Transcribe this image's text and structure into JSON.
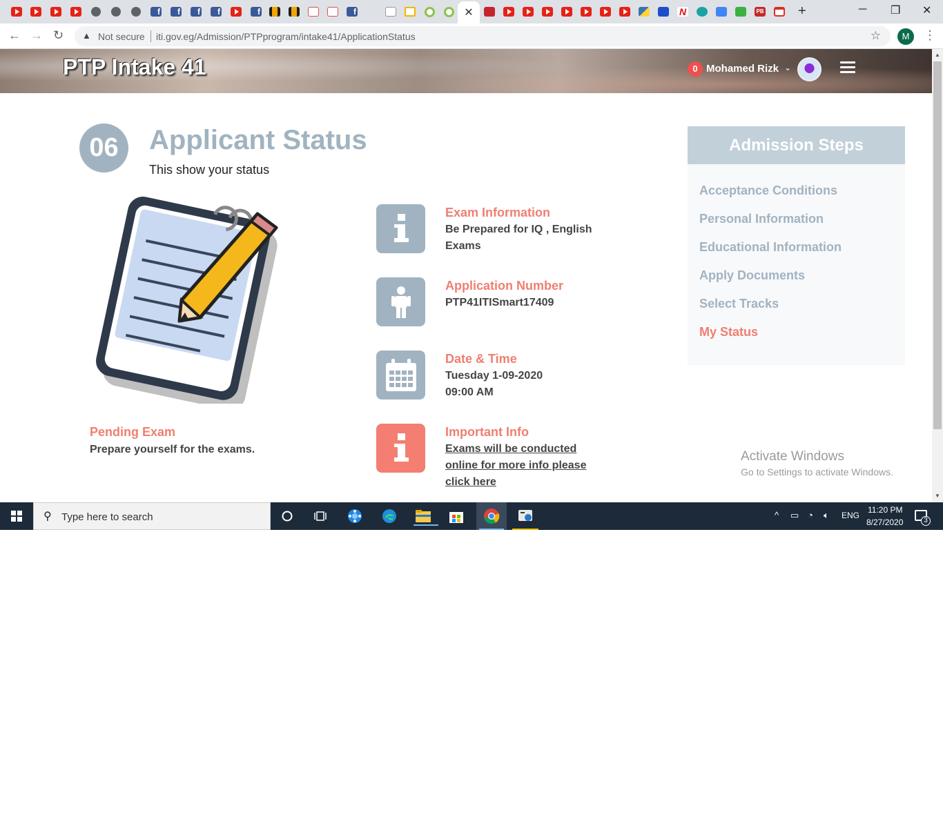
{
  "browser": {
    "tabs": [
      "youtube-tab",
      "youtube-tab",
      "youtube-tab",
      "youtube-tab",
      "globe-tab",
      "globe-tab",
      "globe-tab",
      "facebook-tab",
      "facebook-tab",
      "facebook-tab",
      "facebook-tab",
      "youtube-tab",
      "facebook-tab",
      "bd-tab",
      "bd-tab",
      "calendar-tab",
      "calendar-tab",
      "facebook-tab",
      "a-tab",
      "doc-tab",
      "ring-tab",
      "ring-tab",
      "joomla-tab",
      "active-tab",
      "hi-tab",
      "youtube-tab",
      "youtube-tab",
      "youtube-tab",
      "youtube-tab",
      "youtube-tab",
      "youtube-tab",
      "youtube-tab",
      "python-tab",
      "p-tab",
      "n-tab",
      "eye-tab",
      "translate-tab",
      "green-tab",
      "pb-tab",
      "gmail-tab"
    ],
    "active_tab_close": "✕",
    "new_tab": "+",
    "security_label": "Not secure",
    "url": "iti.gov.eg/Admission/PTPprogram/intake41/ApplicationStatus",
    "profile_initial": "M"
  },
  "header": {
    "brand": "PTP Intake 41",
    "notification_count": "0",
    "username": "Mohamed Rizk"
  },
  "status": {
    "step_number": "06",
    "title": "Applicant Status",
    "subtitle": "This show your status",
    "pending_title": "Pending Exam",
    "pending_text": "Prepare yourself for the exams."
  },
  "info_items": [
    {
      "title": "Exam Information",
      "lines": [
        "Be Prepared for IQ , English",
        "Exams"
      ],
      "icon": "info-icon"
    },
    {
      "title": "Application Number",
      "lines": [
        "PTP41ITISmart17409"
      ],
      "icon": "person-icon"
    },
    {
      "title": "Date & Time",
      "lines": [
        "Tuesday 1-09-2020",
        "09:00 AM"
      ],
      "icon": "calendar-icon"
    },
    {
      "title": "Important Info",
      "lines": [
        "Exams will be conducted",
        "online for more info please",
        "click here"
      ],
      "icon": "info-icon"
    }
  ],
  "admission_steps": {
    "header": "Admission Steps",
    "items": [
      "Acceptance Conditions",
      "Personal Information",
      "Educational Information",
      "Apply Documents",
      "Select Tracks",
      "My Status"
    ],
    "active_index": 5
  },
  "watermark": {
    "line1": "Activate Windows",
    "line2": "Go to Settings to activate Windows."
  },
  "taskbar": {
    "search_placeholder": "Type here to search",
    "language": "ENG",
    "time": "11:20 PM",
    "date": "8/27/2020",
    "notification_count": "3"
  },
  "colors": {
    "accent_salmon": "#f07f71",
    "slate": "#a1b3c0",
    "important_icon": "#f47e71"
  }
}
